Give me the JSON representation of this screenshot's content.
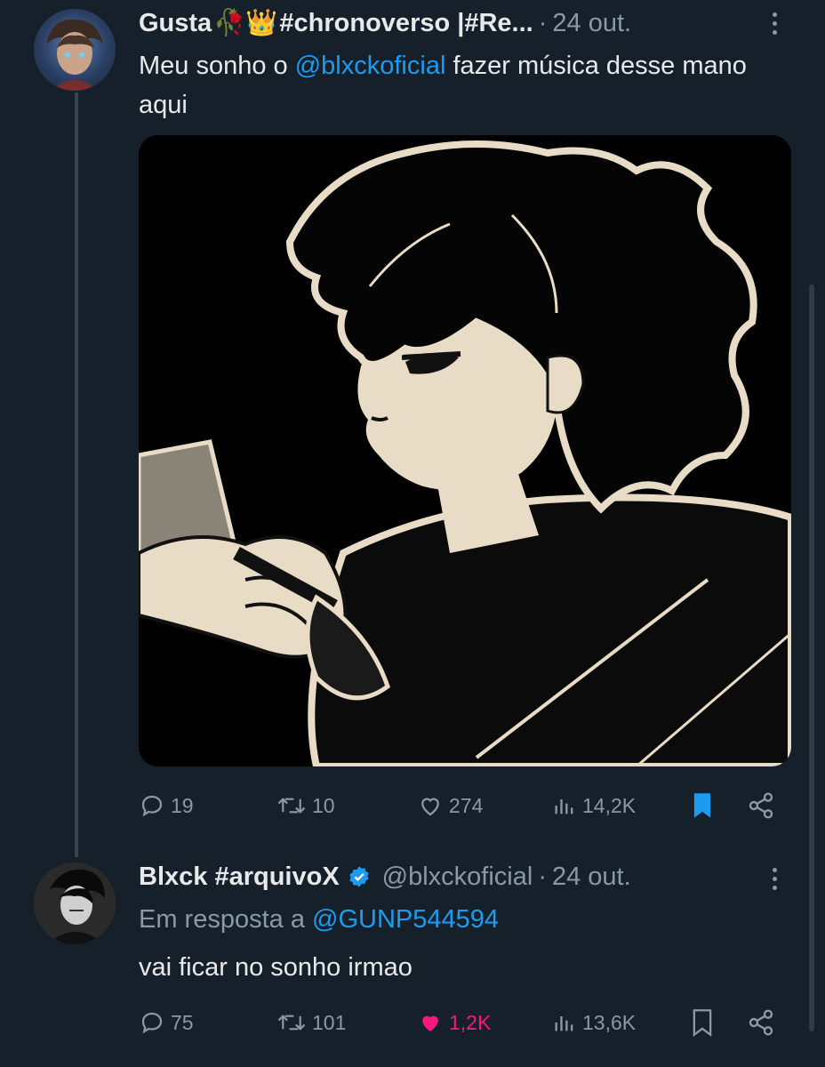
{
  "tweet1": {
    "author_name": "Gusta",
    "author_emojis": "🥀👑",
    "author_suffix": "#chronoverso |#Re...",
    "dot": "·",
    "date": "24 out.",
    "text_prefix": "Meu sonho o ",
    "mention": "@blxckoficial",
    "text_suffix": " fazer música desse mano aqui",
    "actions": {
      "replies": "19",
      "retweets": "10",
      "likes": "274",
      "views": "14,2K"
    },
    "bookmarked": true,
    "media_icon": "anime-boy-illustration"
  },
  "tweet2": {
    "author_name": "Blxck #arquivoX",
    "verified": true,
    "handle": "@blxckoficial",
    "dot": "·",
    "date": "24 out.",
    "reply_prefix": "Em resposta a ",
    "reply_mention": "@GUNP544594",
    "text": "vai ficar no sonho irmao",
    "actions": {
      "replies": "75",
      "retweets": "101",
      "likes": "1,2K",
      "views": "13,6K"
    },
    "liked": true,
    "bookmarked": false
  },
  "colors": {
    "background": "#15202b",
    "text_primary": "#e7e9ea",
    "text_secondary": "#8b98a5",
    "accent": "#1d9bf0",
    "like": "#f91880"
  }
}
